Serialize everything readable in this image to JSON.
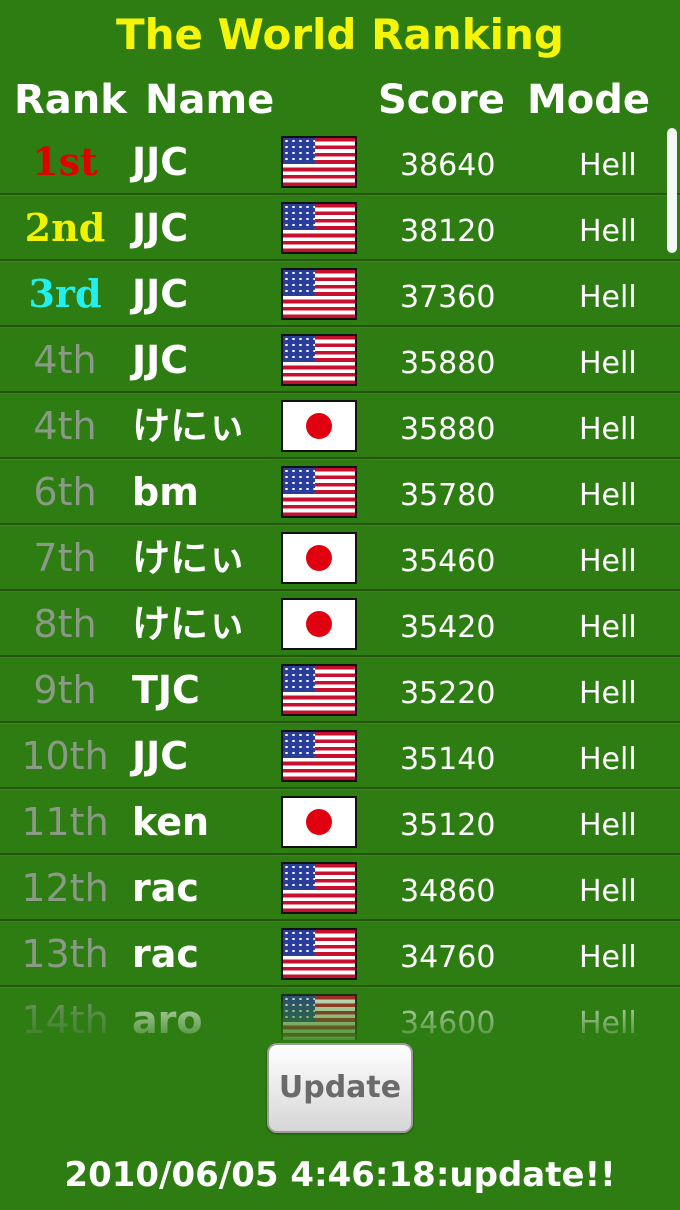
{
  "title": "The World Ranking",
  "columns": {
    "rank": "Rank",
    "name": "Name",
    "score": "Score",
    "mode": "Mode"
  },
  "colors": {
    "background": "#2e7d12",
    "title": "#f5f50a",
    "first": "#e10000",
    "second": "#f2f200",
    "third": "#22f0f0"
  },
  "rows": [
    {
      "rank": "1st",
      "name": "JJC",
      "flag": "us-flag-icon",
      "score": "38640",
      "mode": "Hell"
    },
    {
      "rank": "2nd",
      "name": "JJC",
      "flag": "us-flag-icon",
      "score": "38120",
      "mode": "Hell"
    },
    {
      "rank": "3rd",
      "name": "JJC",
      "flag": "us-flag-icon",
      "score": "37360",
      "mode": "Hell"
    },
    {
      "rank": "4th",
      "name": "JJC",
      "flag": "us-flag-icon",
      "score": "35880",
      "mode": "Hell"
    },
    {
      "rank": "4th",
      "name": "けにぃ",
      "flag": "jp-flag-icon",
      "score": "35880",
      "mode": "Hell"
    },
    {
      "rank": "6th",
      "name": "bm",
      "flag": "us-flag-icon",
      "score": "35780",
      "mode": "Hell"
    },
    {
      "rank": "7th",
      "name": "けにぃ",
      "flag": "jp-flag-icon",
      "score": "35460",
      "mode": "Hell"
    },
    {
      "rank": "8th",
      "name": "けにぃ",
      "flag": "jp-flag-icon",
      "score": "35420",
      "mode": "Hell"
    },
    {
      "rank": "9th",
      "name": "TJC",
      "flag": "us-flag-icon",
      "score": "35220",
      "mode": "Hell"
    },
    {
      "rank": "10th",
      "name": "JJC",
      "flag": "us-flag-icon",
      "score": "35140",
      "mode": "Hell"
    },
    {
      "rank": "11th",
      "name": "ken",
      "flag": "jp-flag-icon",
      "score": "35120",
      "mode": "Hell"
    },
    {
      "rank": "12th",
      "name": "rac",
      "flag": "us-flag-icon",
      "score": "34860",
      "mode": "Hell"
    },
    {
      "rank": "13th",
      "name": "rac",
      "flag": "us-flag-icon",
      "score": "34760",
      "mode": "Hell"
    },
    {
      "rank": "14th",
      "name": "aro",
      "flag": "us-flag-icon",
      "score": "34600",
      "mode": "Hell"
    }
  ],
  "update_button": "Update",
  "footer": "2010/06/05 4:46:18:update!!"
}
